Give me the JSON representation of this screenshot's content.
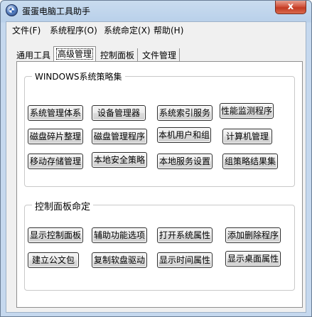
{
  "window": {
    "title": "蛋蛋电脑工具助手",
    "close_symbol": "x"
  },
  "menu": [
    "文件(F)",
    "系统程序(O)",
    "系统命定(X)",
    "帮助(H)"
  ],
  "tabs": [
    {
      "label": "通用工具",
      "active": false
    },
    {
      "label": "高级管理",
      "active": true
    },
    {
      "label": "控制面板",
      "active": false
    },
    {
      "label": "文件管理",
      "active": false
    }
  ],
  "policy_group": {
    "title": "WINDOWS系统策略集",
    "buttons": [
      "系统管理体系",
      "设备管理器",
      "系统索引服务",
      "性能监测程序",
      "磁盘碎片整理",
      "磁盘管理程序",
      "本机用户和组",
      "计算机管理",
      "移动存储管理",
      "本地安全策略",
      "本地服务设置",
      "组策略结果集"
    ]
  },
  "control_group": {
    "title": "控制面板命定",
    "buttons": [
      "显示控制面板",
      "辅助功能选项",
      "打开系统属性",
      "添加删除程序",
      "建立公文包",
      "复制软盘驱动",
      "显示时间属性",
      "显示桌面属性"
    ]
  }
}
